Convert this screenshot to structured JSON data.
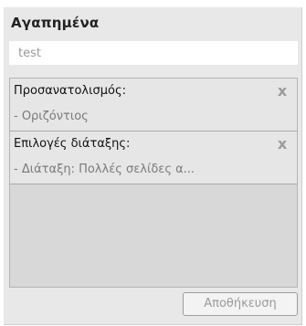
{
  "panel": {
    "title": "Αγαπημένα",
    "name_input": {
      "value": "test",
      "placeholder": ""
    },
    "items": [
      {
        "title": "Προσανατολισμός:",
        "detail": "- Οριζόντιος",
        "remove_glyph": "x"
      },
      {
        "title": "Επιλογές διάταξης:",
        "detail": "- Διάταξη: Πολλές σελίδες α...",
        "remove_glyph": "x"
      }
    ],
    "save_label": "Αποθήκευση"
  },
  "icons": {
    "remove": "close-icon"
  },
  "colors": {
    "panel_bg": "#e8e8e8",
    "list_bg": "#d8d8d8",
    "item_bg": "#e6e6e6",
    "remove_icon": "#9b9b9b",
    "disabled_text": "#9a9a9a"
  }
}
